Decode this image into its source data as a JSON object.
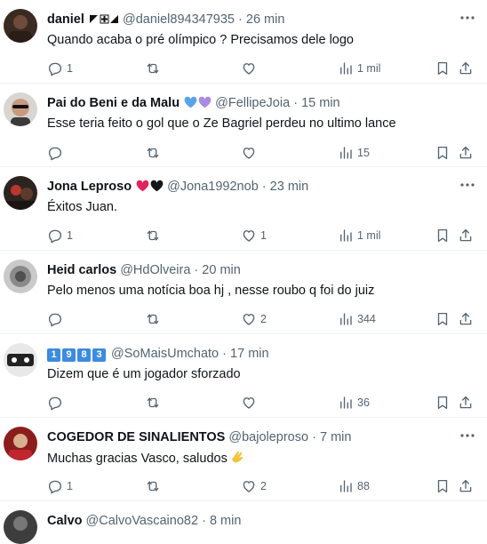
{
  "posts": [
    {
      "name": "daniel",
      "handle": "@daniel894347935",
      "time": "26 min",
      "text": "Quando acaba o pré olímpico ? Precisamos dele logo",
      "replies": "1",
      "retweets": "",
      "likes": "",
      "views": "1 mil"
    },
    {
      "name": "Pai do Beni e da Malu",
      "handle": "@FellipeJoia",
      "time": "15 min",
      "text": "Esse teria feito o gol que o Ze Bagriel perdeu no ultimo lance",
      "replies": "",
      "retweets": "",
      "likes": "",
      "views": "15"
    },
    {
      "name": "Jona Leproso",
      "handle": "@Jona1992nob",
      "time": "23 min",
      "text": "Éxitos Juan.",
      "replies": "1",
      "retweets": "",
      "likes": "1",
      "views": "1 mil"
    },
    {
      "name": "Heid carlos",
      "handle": "@HdOlveira",
      "time": "20 min",
      "text": "Pelo menos uma notícia boa hj , nesse roubo q foi do juiz",
      "replies": "",
      "retweets": "",
      "likes": "2",
      "views": "344"
    },
    {
      "name_badges": [
        "1",
        "9",
        "8",
        "3"
      ],
      "handle": "@SoMaisUmchato",
      "time": "17 min",
      "text": "Dizem que é um jogador sforzado",
      "replies": "",
      "retweets": "",
      "likes": "",
      "views": "36"
    },
    {
      "name": "COGEDOR DE SINALIENTOS",
      "handle": "@bajoleproso",
      "time": "7 min",
      "text": "Muchas gracias Vasco, saludos",
      "replies": "1",
      "retweets": "",
      "likes": "2",
      "views": "88"
    },
    {
      "name": "Calvo",
      "handle": "@CalvoVascaino82",
      "time": "8 min"
    }
  ],
  "separator": "·",
  "icons": {
    "reply": "reply-icon",
    "retweet": "retweet-icon",
    "like": "heart-icon",
    "views": "views-icon",
    "bookmark": "bookmark-icon",
    "share": "share-icon",
    "more": "more-icon"
  },
  "colors": {
    "text": "#0f1419",
    "muted": "#536471",
    "border": "#eff3f4",
    "heart_blue": "#5aa3e8",
    "heart_purple": "#a98be0",
    "heart_red": "#e0245e",
    "heart_black": "#14171a",
    "badge_blue": "#3c8be0"
  }
}
